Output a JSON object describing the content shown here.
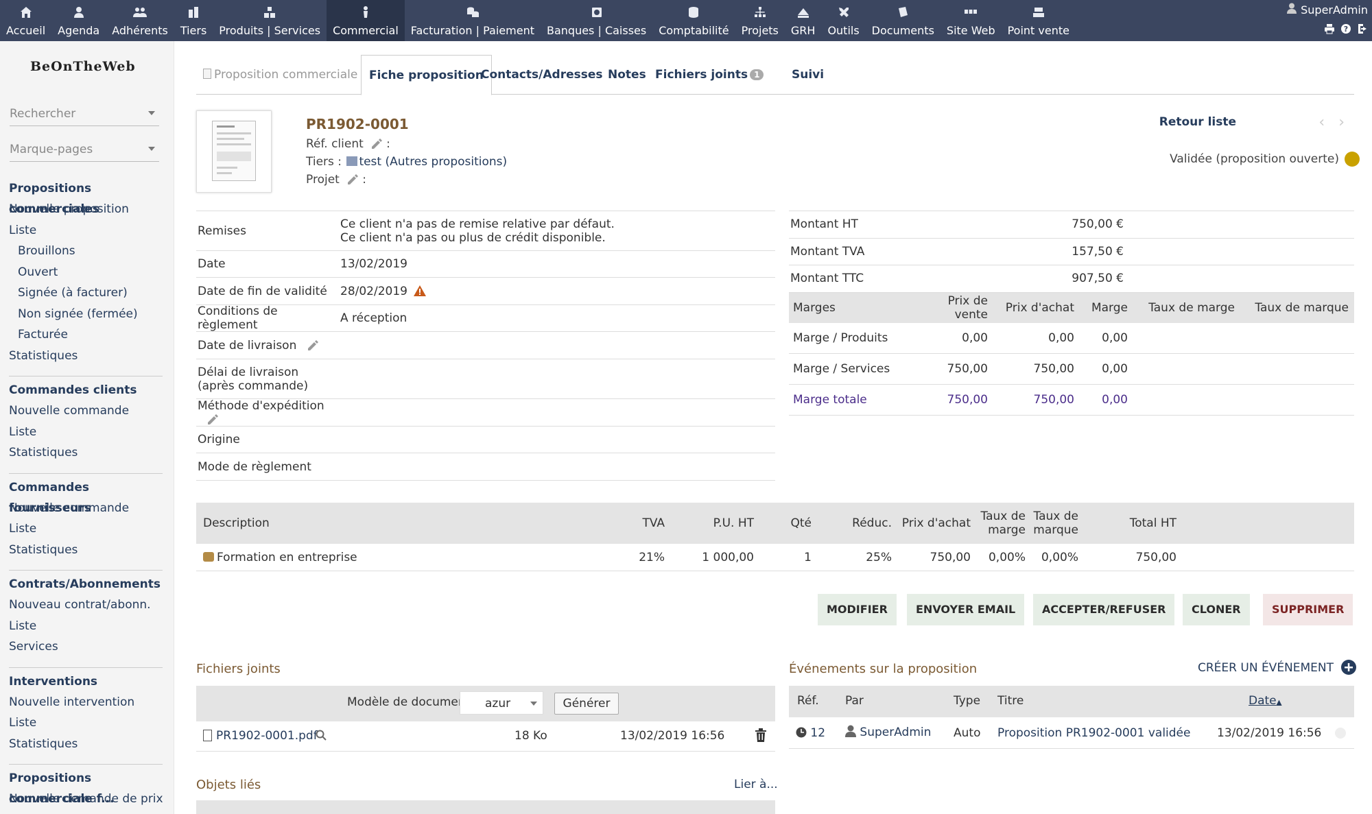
{
  "topmenu": [
    {
      "label": "Accueil",
      "icon": "home-icon"
    },
    {
      "label": "Agenda",
      "icon": "agenda-icon"
    },
    {
      "label": "Adhérents",
      "icon": "members-icon"
    },
    {
      "label": "Tiers",
      "icon": "companies-icon"
    },
    {
      "label": "Produits | Services",
      "icon": "products-icon"
    },
    {
      "label": "Commercial",
      "icon": "commercial-icon",
      "active": true
    },
    {
      "label": "Facturation | Paiement",
      "icon": "billing-icon"
    },
    {
      "label": "Banques | Caisses",
      "icon": "bank-icon"
    },
    {
      "label": "Comptabilité",
      "icon": "accounting-icon"
    },
    {
      "label": "Projets",
      "icon": "projects-icon"
    },
    {
      "label": "GRH",
      "icon": "hrm-icon"
    },
    {
      "label": "Outils",
      "icon": "tools-icon"
    },
    {
      "label": "Documents",
      "icon": "documents-icon"
    },
    {
      "label": "Site Web",
      "icon": "website-icon"
    },
    {
      "label": "Point vente",
      "icon": "pos-icon"
    }
  ],
  "user": {
    "name": "SuperAdmin"
  },
  "sidebar": {
    "logo": "BeOnTheWeb",
    "search_placeholder": "Rechercher",
    "bookmarks_placeholder": "Marque-pages",
    "sections": [
      {
        "title": "Propositions commerciales",
        "items": [
          {
            "label": "Nouvelle proposition",
            "sub": false
          },
          {
            "label": "Liste",
            "sub": false
          },
          {
            "label": "Brouillons",
            "sub": true
          },
          {
            "label": "Ouvert",
            "sub": true
          },
          {
            "label": "Signée (à facturer)",
            "sub": true
          },
          {
            "label": "Non signée (fermée)",
            "sub": true
          },
          {
            "label": "Facturée",
            "sub": true
          },
          {
            "label": "Statistiques",
            "sub": false
          }
        ]
      },
      {
        "title": "Commandes clients",
        "items": [
          {
            "label": "Nouvelle commande",
            "sub": false
          },
          {
            "label": "Liste",
            "sub": false
          },
          {
            "label": "Statistiques",
            "sub": false
          }
        ]
      },
      {
        "title": "Commandes fournisseurs",
        "items": [
          {
            "label": "Nouvelle commande",
            "sub": false
          },
          {
            "label": "Liste",
            "sub": false
          },
          {
            "label": "Statistiques",
            "sub": false
          }
        ]
      },
      {
        "title": "Contrats/Abonnements",
        "items": [
          {
            "label": "Nouveau contrat/abonn.",
            "sub": false
          },
          {
            "label": "Liste",
            "sub": false
          },
          {
            "label": "Services",
            "sub": false
          }
        ]
      },
      {
        "title": "Interventions",
        "items": [
          {
            "label": "Nouvelle intervention",
            "sub": false
          },
          {
            "label": "Liste",
            "sub": false
          },
          {
            "label": "Statistiques",
            "sub": false
          }
        ]
      },
      {
        "title": "Propositions commerciale f...",
        "items": [
          {
            "label": "Nouvelle demande de prix",
            "sub": false
          }
        ]
      }
    ]
  },
  "tabs": {
    "first": "Proposition commerciale",
    "active": "Fiche proposition",
    "contacts": "Contacts/Adresses",
    "notes": "Notes",
    "files": "Fichiers joints",
    "files_count": "1",
    "suivi": "Suivi"
  },
  "header": {
    "ref": "PR1902-0001",
    "ref_client_label": "Réf. client",
    "tiers_label": "Tiers :",
    "tiers_value": "test (Autres propositions)",
    "projet_label": "Projet",
    "colon": ":",
    "retour": "Retour liste",
    "status": "Validée (proposition ouverte)",
    "status_color": "#c9a100"
  },
  "info": {
    "remises_label": "Remises",
    "remises_line1": "Ce client n'a pas de remise relative par défaut.",
    "remises_line2": "Ce client n'a pas ou plus de crédit disponible.",
    "date_label": "Date",
    "date_value": "13/02/2019",
    "fin_label": "Date de fin de validité",
    "fin_value": "28/02/2019",
    "conditions_label": "Conditions de règlement",
    "conditions_value": "A réception",
    "livraison_label": "Date de livraison",
    "delai_label": "Délai de livraison (après commande)",
    "methode_label": "Méthode d'expédition",
    "origine_label": "Origine",
    "mode_label": "Mode de règlement"
  },
  "totals": {
    "ht_label": "Montant HT",
    "ht_value": "750,00 €",
    "tva_label": "Montant TVA",
    "tva_value": "157,50 €",
    "ttc_label": "Montant TTC",
    "ttc_value": "907,50 €"
  },
  "marges": {
    "headers": [
      "Marges",
      "Prix de vente",
      "Prix d'achat",
      "Marge",
      "Taux de marge",
      "Taux de marque"
    ],
    "rows": [
      [
        "Marge / Produits",
        "0,00",
        "0,00",
        "0,00",
        "",
        ""
      ],
      [
        "Marge / Services",
        "750,00",
        "750,00",
        "0,00",
        "",
        ""
      ],
      [
        "Marge totale",
        "750,00",
        "750,00",
        "0,00",
        "",
        ""
      ]
    ]
  },
  "lines": {
    "headers": {
      "desc": "Description",
      "tva": "TVA",
      "pu": "P.U. HT",
      "qte": "Qté",
      "reduc": "Réduc.",
      "achat": "Prix d'achat",
      "taux_marge": "Taux de marge",
      "taux_marque": "Taux de marque",
      "total": "Total HT"
    },
    "rows": [
      {
        "desc": "Formation en entreprise",
        "tva": "21%",
        "pu": "1 000,00",
        "qte": "1",
        "reduc": "25%",
        "achat": "750,00",
        "taux_marge": "0,00%",
        "taux_marque": "0,00%",
        "total": "750,00"
      }
    ]
  },
  "actions": {
    "modifier": "MODIFIER",
    "email": "ENVOYER EMAIL",
    "accepter": "ACCEPTER/REFUSER",
    "cloner": "CLONER",
    "supprimer": "SUPPRIMER"
  },
  "files": {
    "title": "Fichiers joints",
    "model_label": "Modèle de document",
    "model_value": "azur",
    "generate": "Générer",
    "rows": [
      {
        "name": "PR1902-0001.pdf",
        "size": "18 Ko",
        "date": "13/02/2019 16:56"
      }
    ]
  },
  "events": {
    "title": "Événements sur la proposition",
    "create": "CRÉER UN ÉVÉNEMENT",
    "headers": {
      "ref": "Réf.",
      "par": "Par",
      "type": "Type",
      "titre": "Titre",
      "date": "Date"
    },
    "rows": [
      {
        "ref": "12",
        "par": "SuperAdmin",
        "type": "Auto",
        "titre": "Proposition PR1902-0001 validée",
        "date": "13/02/2019 16:56"
      }
    ]
  },
  "linked": {
    "title": "Objets liés",
    "link": "Lier à..."
  },
  "colors": {
    "topbar": "#3b4660",
    "link": "#263c5c",
    "section_title": "#7b5a33",
    "total_margin": "#4b2d8a"
  }
}
